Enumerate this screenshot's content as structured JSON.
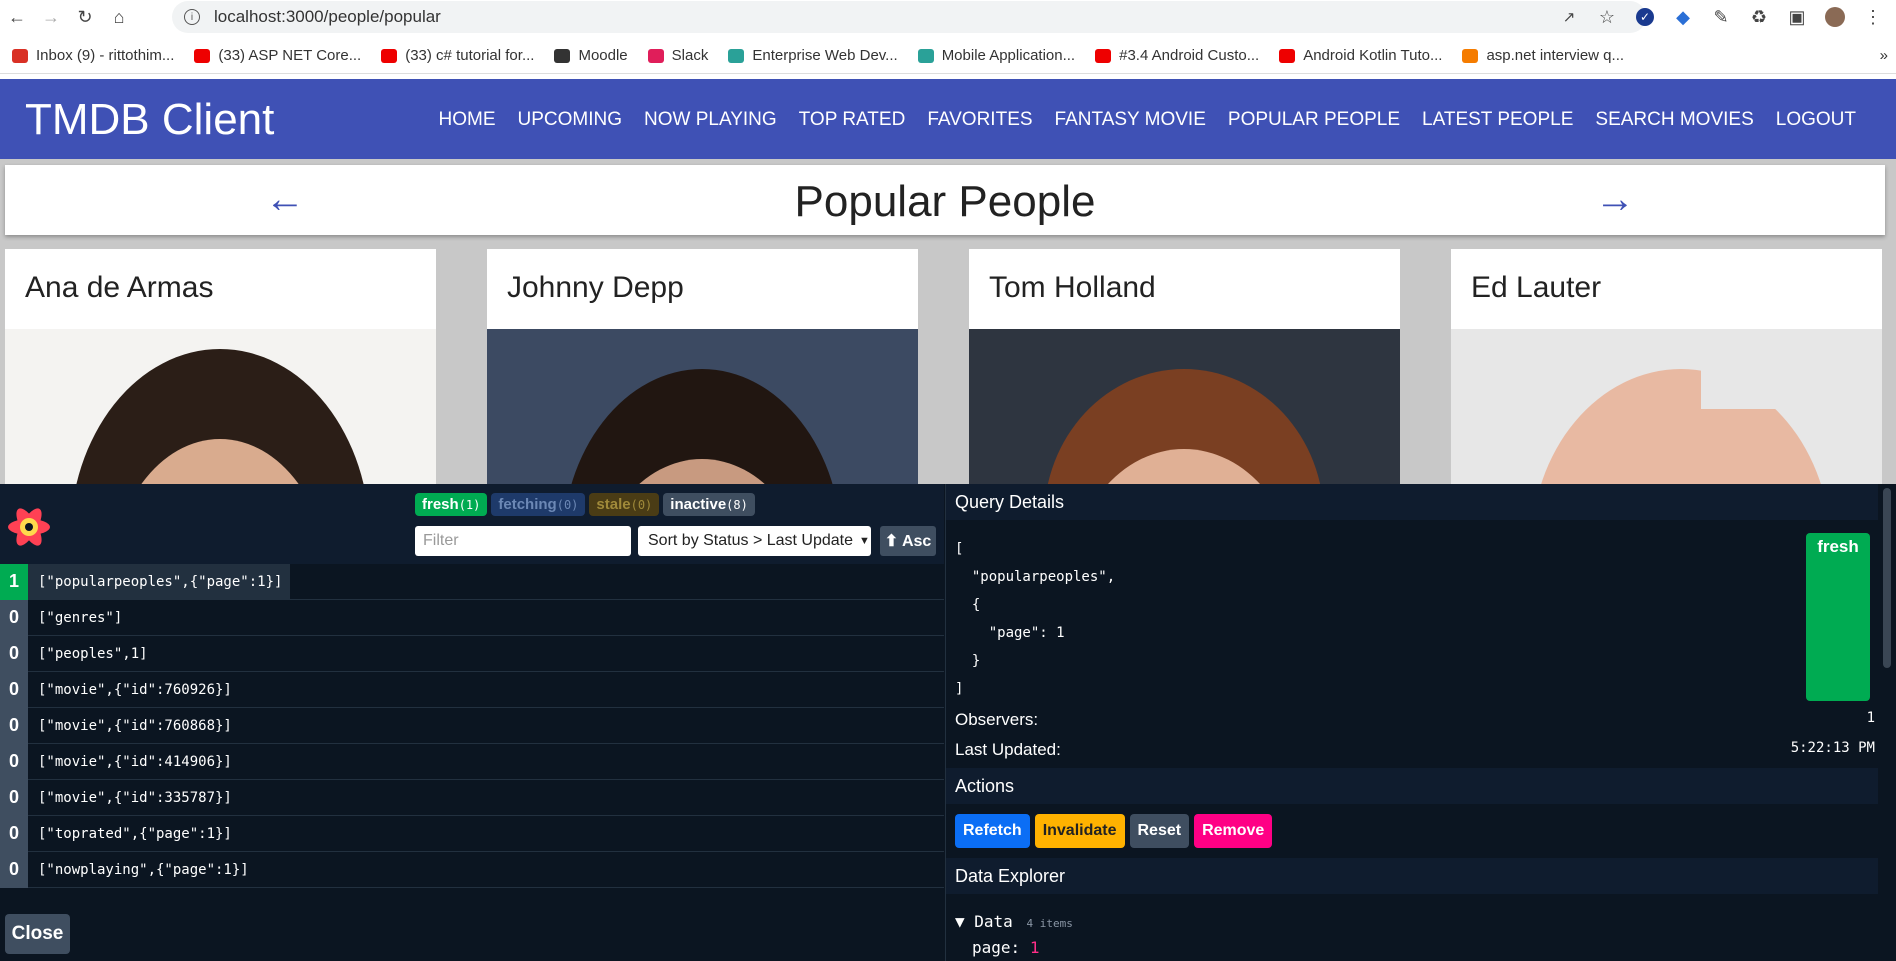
{
  "browser": {
    "url": "localhost:3000/people/popular",
    "bookmarks": [
      {
        "label": "Inbox (9) - rittothim...",
        "color": "#d93025"
      },
      {
        "label": "(33) ASP NET Core...",
        "color": "#e00"
      },
      {
        "label": "(33) c# tutorial for...",
        "color": "#e00"
      },
      {
        "label": "Moodle",
        "color": "#333"
      },
      {
        "label": "Slack",
        "color": "#e01e5a"
      },
      {
        "label": "Enterprise Web Dev...",
        "color": "#2aa198"
      },
      {
        "label": "Mobile Application...",
        "color": "#2aa198"
      },
      {
        "label": "#3.4 Android Custo...",
        "color": "#e00"
      },
      {
        "label": "Android Kotlin Tuto...",
        "color": "#e00"
      },
      {
        "label": "asp.net interview q...",
        "color": "#f57c00"
      }
    ]
  },
  "app": {
    "brand": "TMDB Client",
    "nav": [
      "HOME",
      "UPCOMING",
      "NOW PLAYING",
      "TOP RATED",
      "FAVORITES",
      "FANTASY MOVIE",
      "POPULAR PEOPLE",
      "LATEST PEOPLE",
      "SEARCH MOVIES",
      "LOGOUT"
    ],
    "page_title": "Popular People",
    "people": [
      "Ana de Armas",
      "Johnny Depp",
      "Tom Holland",
      "Ed Lauter"
    ],
    "accent": "#3f51b5"
  },
  "devtools": {
    "badges": [
      {
        "label": "fresh",
        "count": "(1)",
        "bg": "#00ab52",
        "fg": "#fff"
      },
      {
        "label": "fetching",
        "count": "(0)",
        "bg": "#1e3a6a",
        "fg": "#6c88b5"
      },
      {
        "label": "stale",
        "count": "(0)",
        "bg": "#4a3c15",
        "fg": "#a08a3a"
      },
      {
        "label": "inactive",
        "count": "(8)",
        "bg": "#3f4e60",
        "fg": "#fff"
      }
    ],
    "filter_placeholder": "Filter",
    "sort_label": "Sort by Status > Last Update",
    "asc_label": "⬆ Asc",
    "queries": [
      {
        "count": "1",
        "key": "[\"popularpeoples\",{\"page\":1}]",
        "active": true
      },
      {
        "count": "0",
        "key": "[\"genres\"]",
        "active": false
      },
      {
        "count": "0",
        "key": "[\"peoples\",1]",
        "active": false
      },
      {
        "count": "0",
        "key": "[\"movie\",{\"id\":760926}]",
        "active": false
      },
      {
        "count": "0",
        "key": "[\"movie\",{\"id\":760868}]",
        "active": false
      },
      {
        "count": "0",
        "key": "[\"movie\",{\"id\":414906}]",
        "active": false
      },
      {
        "count": "0",
        "key": "[\"movie\",{\"id\":335787}]",
        "active": false
      },
      {
        "count": "0",
        "key": "[\"toprated\",{\"page\":1}]",
        "active": false
      },
      {
        "count": "0",
        "key": "[\"nowplaying\",{\"page\":1}]",
        "active": false
      }
    ],
    "close_label": "Close",
    "details": {
      "heading": "Query Details",
      "json_text": "[\n  \"popularpeoples\",\n  {\n    \"page\": 1\n  }\n]",
      "status": "fresh",
      "observers_label": "Observers:",
      "observers_value": "1",
      "updated_label": "Last Updated:",
      "updated_value": "5:22:13 PM",
      "actions_heading": "Actions",
      "actions": [
        {
          "label": "Refetch",
          "bg": "#0b6ef5",
          "fg": "#fff"
        },
        {
          "label": "Invalidate",
          "bg": "#ffb200",
          "fg": "#222"
        },
        {
          "label": "Reset",
          "bg": "#3f4e60",
          "fg": "#fff"
        },
        {
          "label": "Remove",
          "bg": "#ff0085",
          "fg": "#fff"
        }
      ],
      "explorer_heading": "Data Explorer",
      "data_label": "Data",
      "data_items": "4 items",
      "page_key": "page:",
      "page_value": "1"
    }
  }
}
